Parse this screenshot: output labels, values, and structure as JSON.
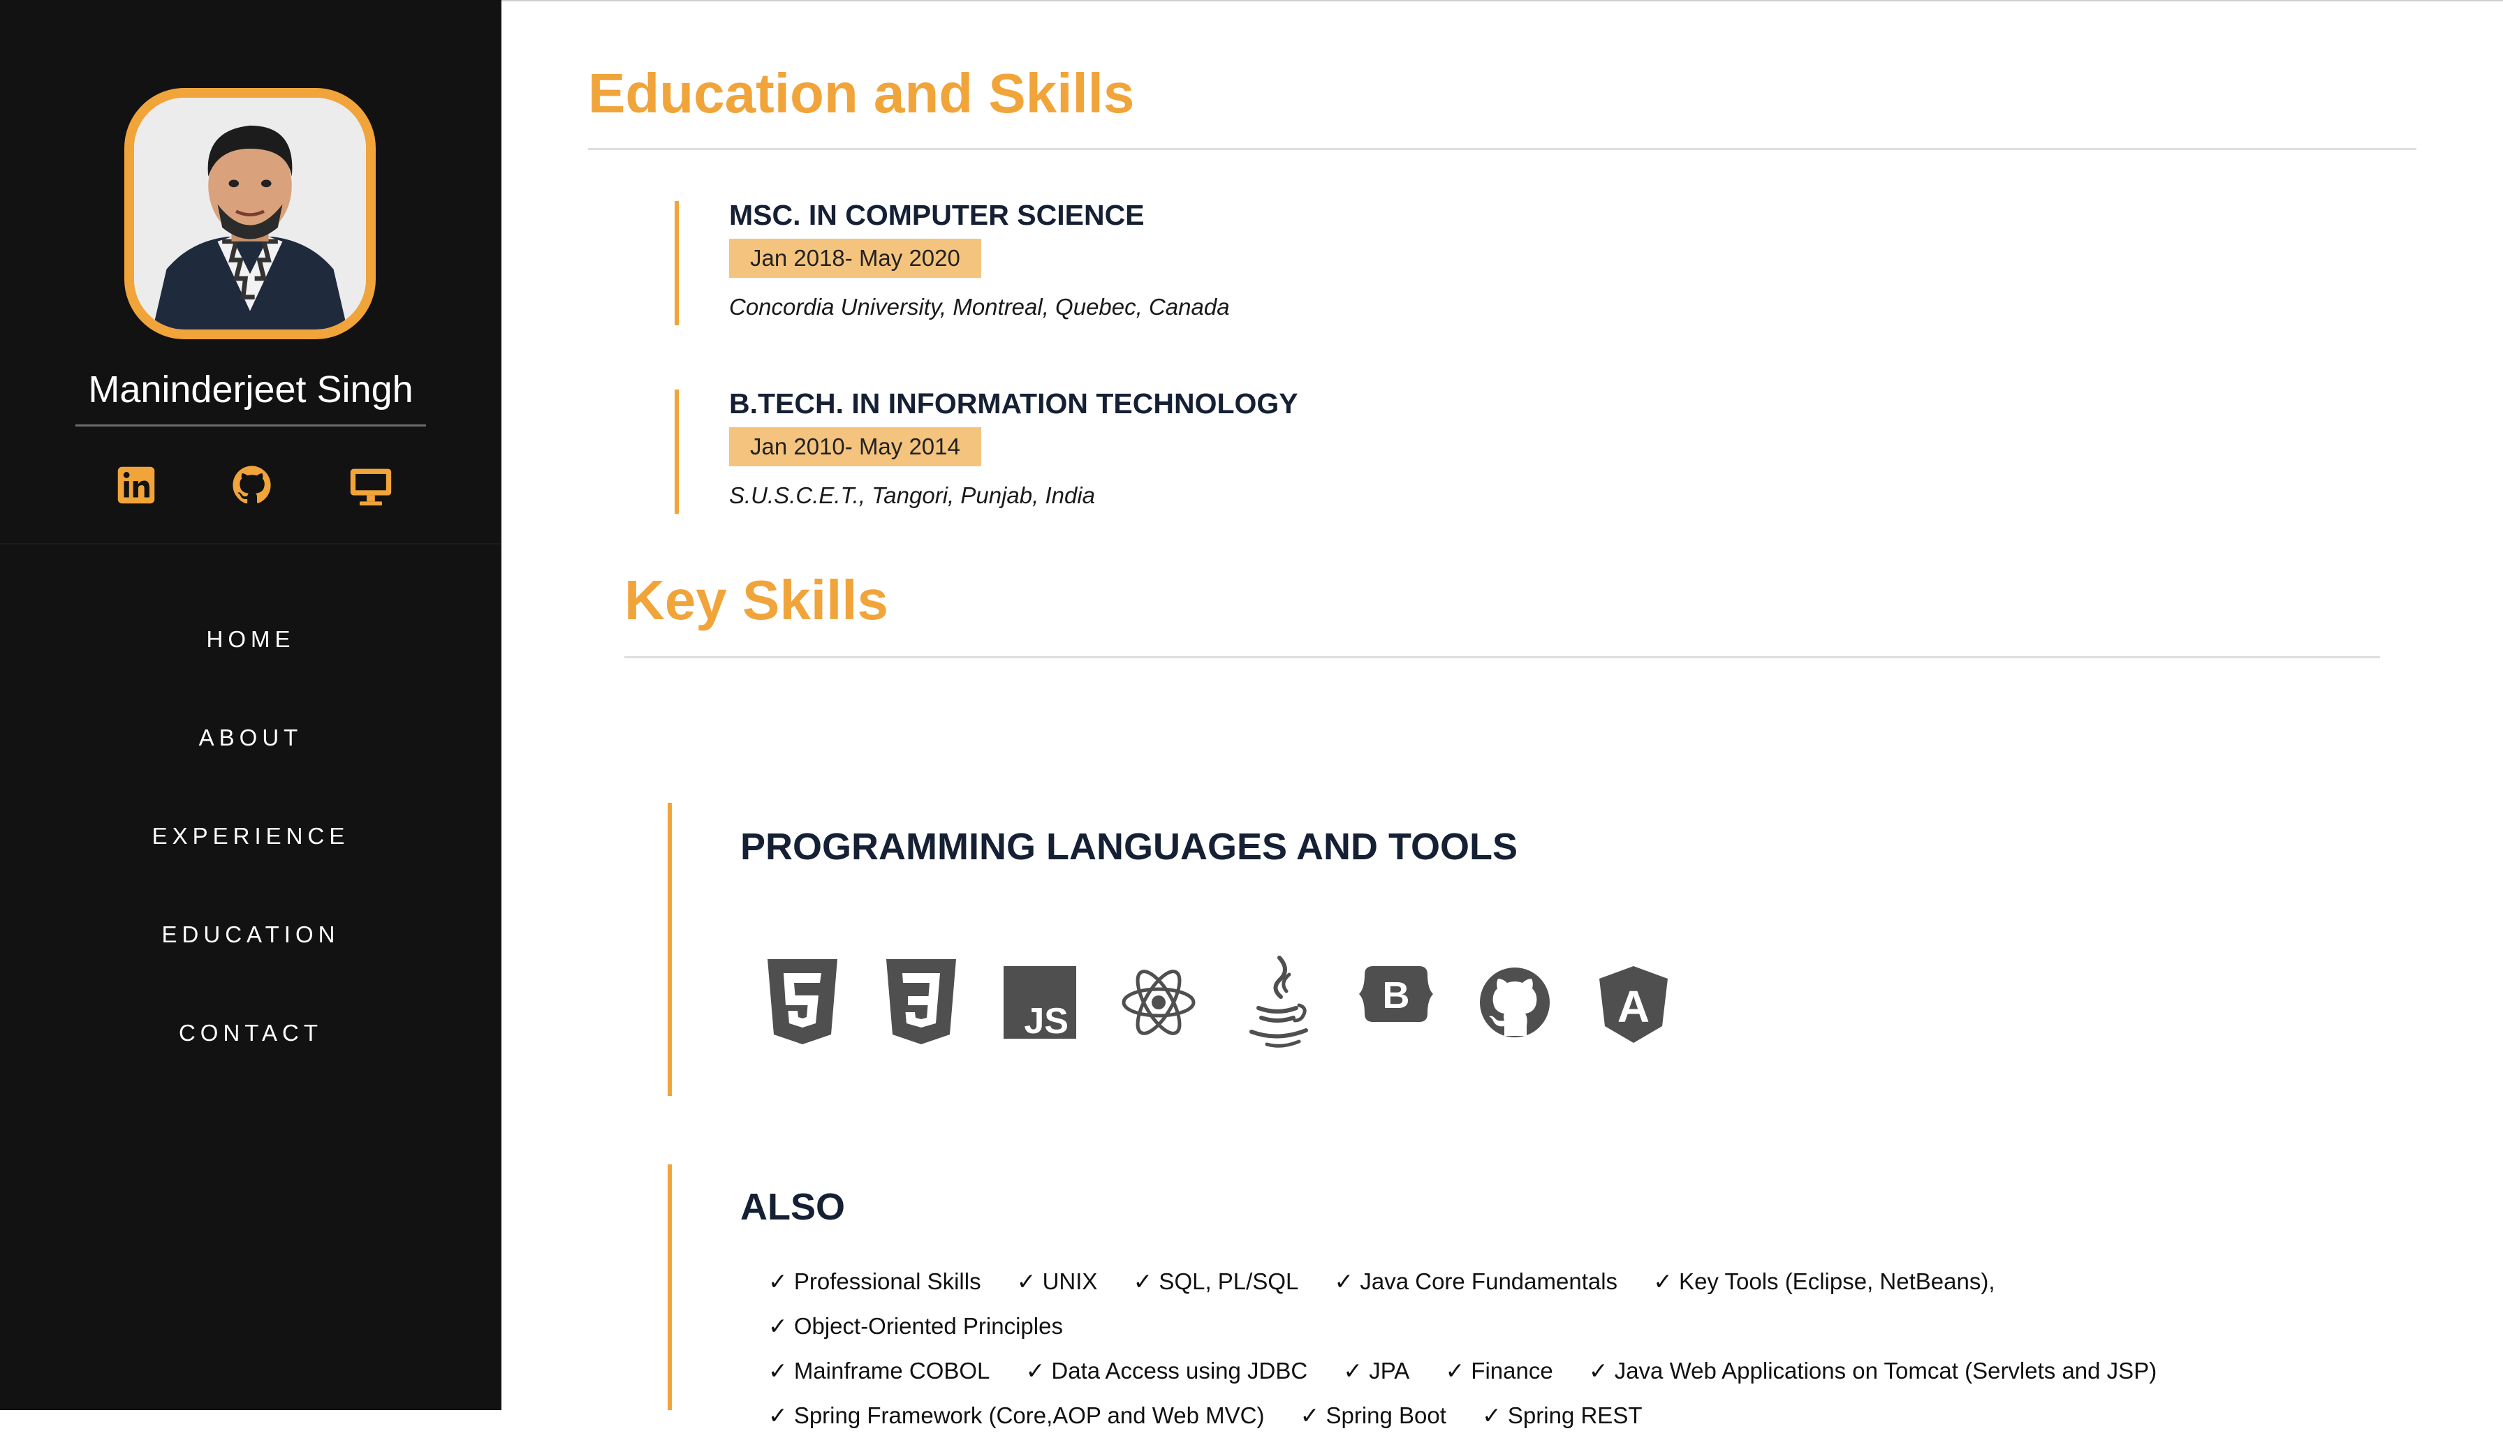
{
  "sidebar": {
    "name": "Maninderjeet Singh",
    "social": [
      {
        "icon": "linkedin-icon"
      },
      {
        "icon": "github-icon"
      },
      {
        "icon": "desktop-monitor-icon"
      }
    ],
    "nav": [
      "HOME",
      "ABOUT",
      "EXPERIENCE",
      "EDUCATION",
      "CONTACT"
    ]
  },
  "education": {
    "title": "Education and Skills",
    "items": [
      {
        "degree": "MSC. IN COMPUTER SCIENCE",
        "dates": "Jan 2018- May 2020",
        "school": "Concordia University, Montreal, Quebec, Canada"
      },
      {
        "degree": "B.TECH. IN INFORMATION TECHNOLOGY",
        "dates": "Jan 2010- May 2014",
        "school": "S.U.S.C.E.T., Tangori, Punjab, India"
      }
    ]
  },
  "skills": {
    "title": "Key Skills",
    "programming": {
      "title": "PROGRAMMING LANGUAGES AND TOOLS",
      "icons": [
        "html5-icon",
        "css3-icon",
        "javascript-icon",
        "react-icon",
        "java-icon",
        "bootstrap-icon",
        "github-icon",
        "angular-icon"
      ],
      "js_glyph": "JS",
      "bootstrap_glyph": "B",
      "angular_glyph": "A"
    },
    "also": {
      "title": "ALSO",
      "items": [
        "✓ Professional Skills",
        "✓ UNIX",
        "✓ SQL, PL/SQL",
        "✓ Java Core Fundamentals",
        "✓ Key Tools (Eclipse, NetBeans),",
        "✓ Object-Oriented Principles",
        "✓ Mainframe COBOL",
        "✓ Data Access using JDBC",
        "✓ JPA",
        "✓ Finance",
        "✓ Java Web Applications on Tomcat (Servlets and JSP)",
        "✓ Spring Framework (Core,AOP and Web MVC)",
        "✓ Spring Boot",
        "✓ Spring REST"
      ]
    }
  },
  "colors": {
    "accent": "#f0a43a",
    "sidebar_bg": "#121212",
    "heading": "#152034",
    "date_bg": "#f4c47f",
    "icon_gray": "#4f4f4f"
  }
}
